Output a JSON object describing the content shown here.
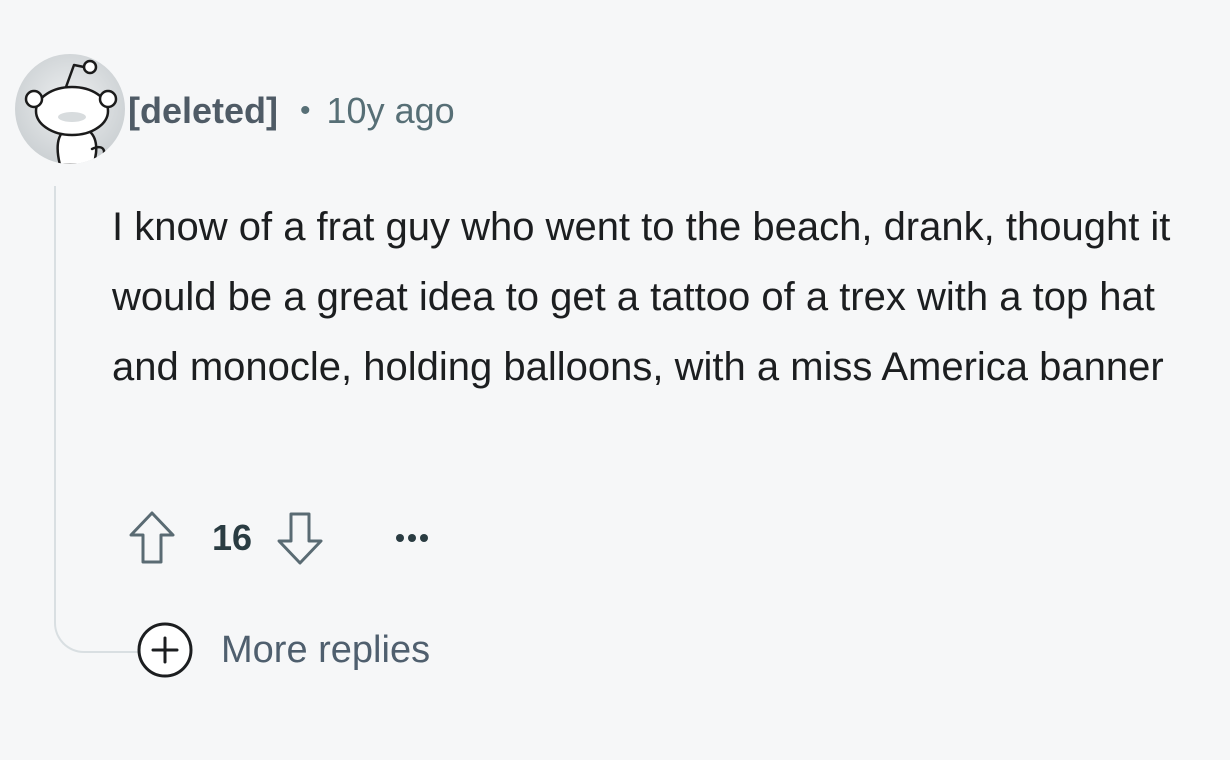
{
  "comment": {
    "author": "[deleted]",
    "separator": "•",
    "timestamp": "10y ago",
    "body": "I know of a frat guy who went to the beach, drank, thought it would be a great idea to get a tattoo of a trex with a top hat and monocle, holding balloons, with a miss America banner",
    "score": "16",
    "avatar_icon": "snoo-avatar-icon",
    "upvote_icon": "upvote-arrow-icon",
    "downvote_icon": "downvote-arrow-icon",
    "overflow_icon": "ellipsis-icon"
  },
  "more_replies": {
    "label": "More replies",
    "icon": "plus-circle-icon"
  },
  "colors": {
    "background": "#f6f7f8",
    "author": "#4f5b66",
    "meta": "#576f76",
    "body": "#1c1e20",
    "thread_line": "#d9dfe2"
  }
}
